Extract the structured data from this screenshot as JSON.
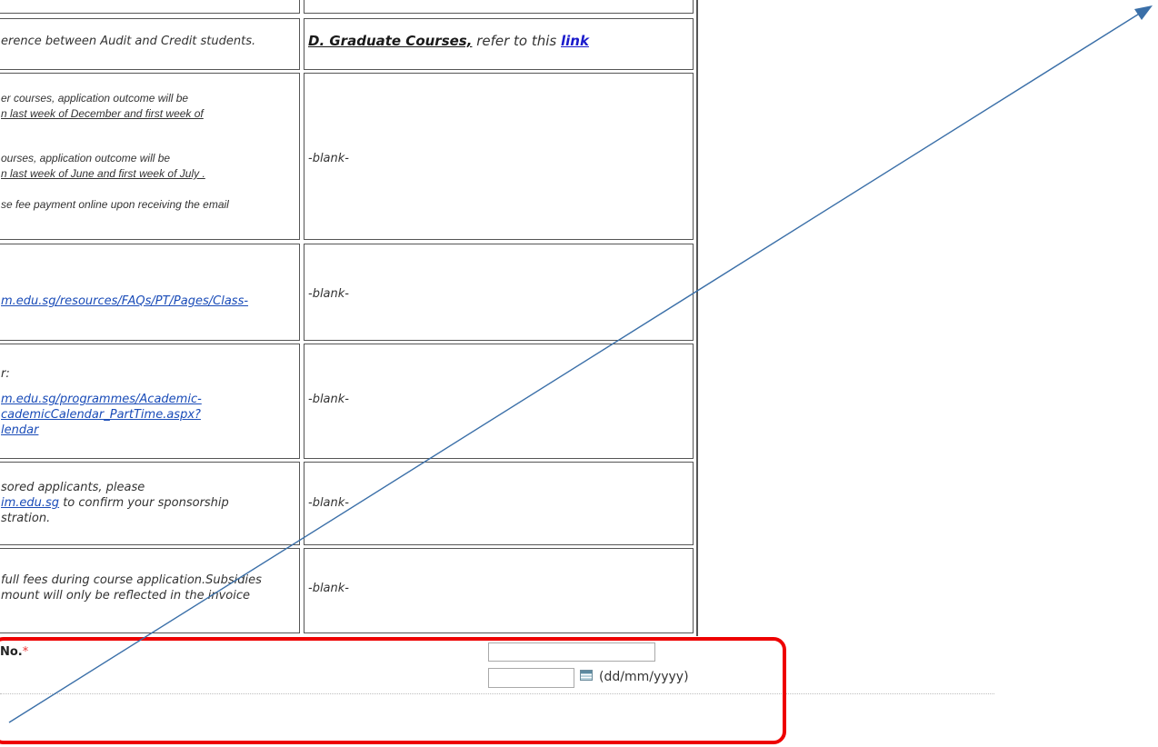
{
  "table": {
    "header_left": "erence between Audit and Credit students.",
    "header_right_prefix": "D. Graduate Courses,",
    "header_right_mid": " refer to this ",
    "header_right_link": "link",
    "blank_label": "-blank-",
    "row1": {
      "l1": "er courses, application outcome will be",
      "l2": "n last week of December and first week of",
      "l3": "ourses, application outcome will be",
      "l4": "n last week of June and first week of July .",
      "l5": "se fee payment online upon receiving the email"
    },
    "row2": {
      "link": "m.edu.sg/resources/FAQs/PT/Pages/Class-"
    },
    "row3": {
      "l1": "r:",
      "link1": "m.edu.sg/programmes/Academic-",
      "link2": "cademicCalendar_PartTime.aspx?",
      "link3": "lendar"
    },
    "row4": {
      "l1": "sored applicants, please",
      "link": "im.edu.sg",
      "l2_rest": " to confirm your sponsorship",
      "l3": "stration."
    },
    "row5": {
      "l1": " full fees during course application.Subsidies",
      "l2": "mount will only be reflected in the invoice"
    }
  },
  "form": {
    "field_label": "No.",
    "required_mark": "*",
    "id_value": "",
    "date_value": "",
    "date_format": "(dd/mm/yyyy)",
    "calendar_icon": "calendar-icon"
  },
  "annotation": {
    "highlight_color": "#ee0000",
    "arrow_color": "#3a6fa8"
  }
}
